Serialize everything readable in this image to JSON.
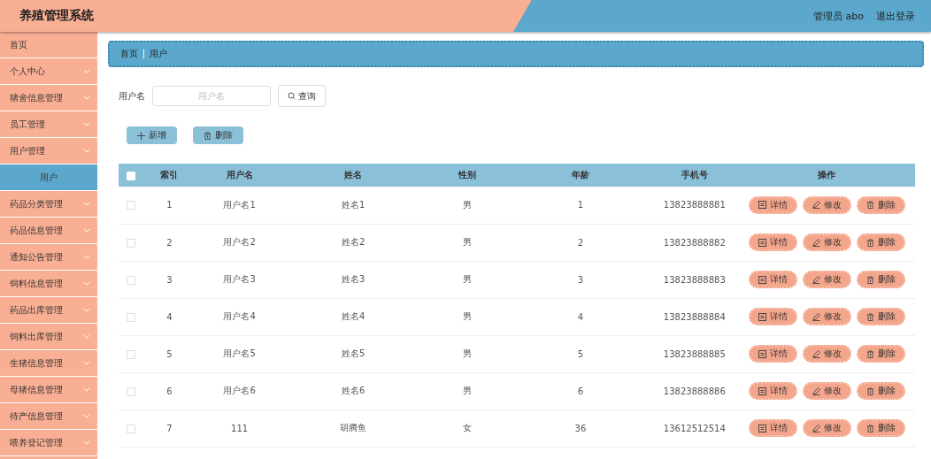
{
  "header": {
    "title": "养殖管理系统",
    "user": "管理员 abo",
    "logout": "退出登录"
  },
  "sidebar": {
    "items": [
      {
        "label": "首页",
        "kind": "link",
        "selected": false
      },
      {
        "label": "个人中心",
        "kind": "submenu"
      },
      {
        "label": "猪舍信息管理",
        "kind": "submenu"
      },
      {
        "label": "员工管理",
        "kind": "submenu"
      },
      {
        "label": "用户管理",
        "kind": "submenu",
        "children": [
          {
            "label": "用户",
            "selected": true
          }
        ]
      },
      {
        "label": "药品分类管理",
        "kind": "submenu"
      },
      {
        "label": "药品信息管理",
        "kind": "submenu"
      },
      {
        "label": "通知公告管理",
        "kind": "submenu"
      },
      {
        "label": "饲料信息管理",
        "kind": "submenu"
      },
      {
        "label": "药品出库管理",
        "kind": "submenu"
      },
      {
        "label": "饲料出库管理",
        "kind": "submenu"
      },
      {
        "label": "生猪信息管理",
        "kind": "submenu"
      },
      {
        "label": "母猪信息管理",
        "kind": "submenu"
      },
      {
        "label": "待产信息管理",
        "kind": "submenu"
      },
      {
        "label": "喂养登记管理",
        "kind": "submenu"
      }
    ]
  },
  "breadcrumb": [
    "首页",
    "用户"
  ],
  "search": {
    "label": "用户名",
    "placeholder": "用户名",
    "button": "查询"
  },
  "toolbar": [
    "新增",
    "删除"
  ],
  "table": {
    "all_checked": false,
    "columns": [
      "索引",
      "用户名",
      "姓名",
      "性别",
      "年龄",
      "手机号",
      "操作"
    ],
    "rows": [
      {
        "checked": false,
        "cells": [
          "1",
          "用户名1",
          "姓名1",
          "男",
          "1",
          "13823888881"
        ],
        "actions": [
          "详情",
          "修改",
          "删除"
        ]
      },
      {
        "checked": false,
        "cells": [
          "2",
          "用户名2",
          "姓名2",
          "男",
          "2",
          "13823888882"
        ],
        "actions": [
          "详情",
          "修改",
          "删除"
        ]
      },
      {
        "checked": false,
        "cells": [
          "3",
          "用户名3",
          "姓名3",
          "男",
          "3",
          "13823888883"
        ],
        "actions": [
          "详情",
          "修改",
          "删除"
        ]
      },
      {
        "checked": false,
        "cells": [
          "4",
          "用户名4",
          "姓名4",
          "男",
          "4",
          "13823888884"
        ],
        "actions": [
          "详情",
          "修改",
          "删除"
        ]
      },
      {
        "checked": false,
        "cells": [
          "5",
          "用户名5",
          "姓名5",
          "男",
          "5",
          "13823888885"
        ],
        "actions": [
          "详情",
          "修改",
          "删除"
        ]
      },
      {
        "checked": false,
        "cells": [
          "6",
          "用户名6",
          "姓名6",
          "男",
          "6",
          "13823888886"
        ],
        "actions": [
          "详情",
          "修改",
          "删除"
        ]
      },
      {
        "checked": false,
        "cells": [
          "7",
          "111",
          "胡腾鱼",
          "女",
          "36",
          "13612512514"
        ],
        "actions": [
          "详情",
          "修改",
          "删除"
        ]
      }
    ]
  }
}
